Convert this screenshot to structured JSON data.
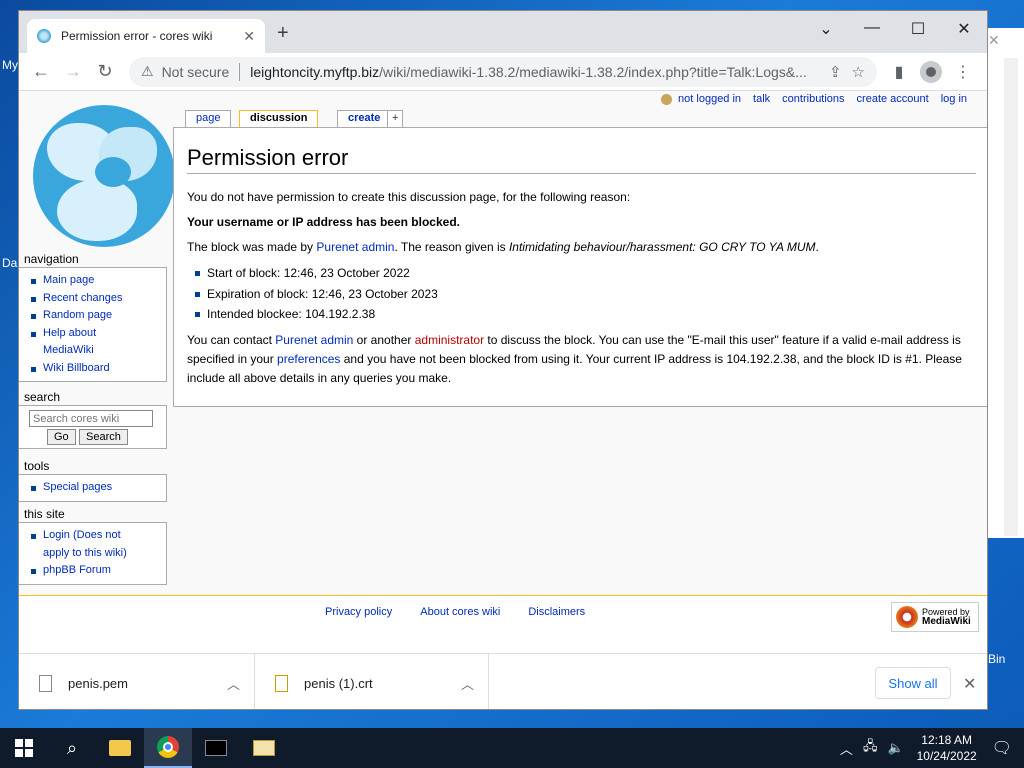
{
  "desktop": {
    "labels": [
      "My",
      "Da",
      "Bin"
    ]
  },
  "browser": {
    "tab_title": "Permission error - cores wiki",
    "new_tab": "+",
    "window_controls": {
      "minimize": "—",
      "maximize": "☐",
      "close": "✕",
      "tab_search": "⌄"
    },
    "not_secure": "Not secure",
    "url_host": "leightoncity.myftp.biz",
    "url_path": "/wiki/mediawiki-1.38.2/mediawiki-1.38.2/index.php?title=Talk:Logs&..."
  },
  "wiki": {
    "personal_tools": [
      "not logged in",
      "talk",
      "contributions",
      "create account",
      "log in"
    ],
    "tabs": [
      "page",
      "discussion",
      "create",
      "+"
    ],
    "navigation": {
      "heading": "navigation",
      "items": [
        "Main page",
        "Recent changes",
        "Random page",
        "Help about",
        "MediaWiki",
        "Wiki Billboard"
      ]
    },
    "search": {
      "heading": "search",
      "placeholder": "Search cores wiki",
      "go": "Go",
      "search": "Search"
    },
    "tools": {
      "heading": "tools",
      "items": [
        "Special pages"
      ]
    },
    "this_site": {
      "heading": "this site",
      "login_l1": "Login (Does not",
      "login_l2": "apply to this wiki)",
      "forum": "phpBB Forum"
    },
    "content": {
      "title": "Permission error",
      "p1": "You do not have permission to create this discussion page, for the following reason:",
      "p2": "Your username or IP address has been blocked.",
      "p3_a": "The block was made by ",
      "p3_link": "Purenet admin",
      "p3_b": ". The reason given is ",
      "p3_reason": "Intimidating behaviour/harassment: GO CRY TO YA MUM",
      "p3_c": ".",
      "list": [
        "Start of block: 12:46, 23 October 2022",
        "Expiration of block: 12:46, 23 October 2023",
        "Intended blockee: 104.192.2.38"
      ],
      "p4_a": "You can contact ",
      "p4_link1": "Purenet admin",
      "p4_b": " or another ",
      "p4_link2": "administrator",
      "p4_c": " to discuss the block. You can use the \"E-mail this user\" feature if a valid e-mail address is specified in your ",
      "p4_link3": "preferences",
      "p4_d": " and you have not been blocked from using it. Your current IP address is 104.192.2.38, and the block ID is #1. Please include all above details in any queries you make."
    },
    "footer": {
      "links": [
        "Privacy policy",
        "About cores wiki",
        "Disclaimers"
      ],
      "powered_l1": "Powered by",
      "powered_l2": "MediaWiki"
    }
  },
  "downloads": {
    "items": [
      "penis.pem",
      "penis (1).crt"
    ],
    "show_all": "Show all",
    "close": "✕"
  },
  "taskbar": {
    "time": "12:18 AM",
    "date": "10/24/2022"
  }
}
